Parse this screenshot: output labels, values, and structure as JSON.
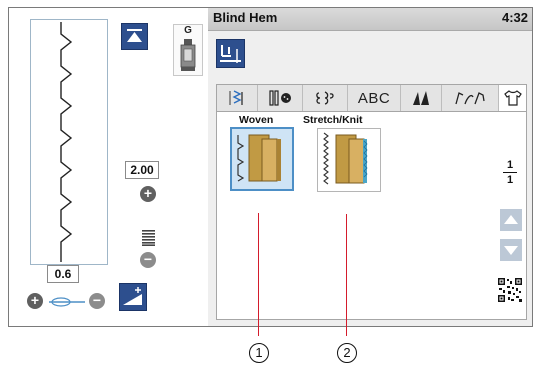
{
  "title_bar": {
    "title": "Blind Hem",
    "time": "4:32"
  },
  "needle_position_button": {
    "icon": "needle-position-up-icon"
  },
  "presser_foot": {
    "letter": "G",
    "icon": "presser-foot-icon"
  },
  "stitch_length": {
    "value": "2.00",
    "plus": "+",
    "minus": "−",
    "icon": "stitch-density-icon"
  },
  "thread_tension": {
    "value": "0.6",
    "plus": "+",
    "minus": "−",
    "icon": "thread-tension-icon"
  },
  "tapering_button": {
    "icon": "tapering-icon"
  },
  "stitch_settings_button": {
    "icon": "stitch-settings-icon"
  },
  "tabs": [
    {
      "name": "utility-stitches",
      "icon": "utility-stitch-icon",
      "label": ""
    },
    {
      "name": "buttonhole",
      "icon": "buttonhole-icon",
      "label": ""
    },
    {
      "name": "decorative",
      "icon": "decorative-stitch-icon",
      "label": ""
    },
    {
      "name": "alphabet",
      "icon": "",
      "label": "ABC"
    },
    {
      "name": "quilt",
      "icon": "quilt-icon",
      "label": ""
    },
    {
      "name": "combination",
      "icon": "combination-stitch-icon",
      "label": ""
    },
    {
      "name": "garment",
      "icon": "shirt-icon",
      "label": ""
    }
  ],
  "patterns": [
    {
      "label": "Woven",
      "selected": true,
      "icon": "woven-blind-hem-icon"
    },
    {
      "label": "Stretch/Knit",
      "selected": false,
      "icon": "stretch-knit-blind-hem-icon"
    }
  ],
  "page": {
    "current": "1",
    "total": "1"
  },
  "callouts": [
    "1",
    "2"
  ],
  "colors": {
    "accent": "#2d4f8e",
    "selected_bg": "#cfe4f5",
    "selected_border": "#4d8fc6",
    "callout_line": "#d41c2c"
  }
}
